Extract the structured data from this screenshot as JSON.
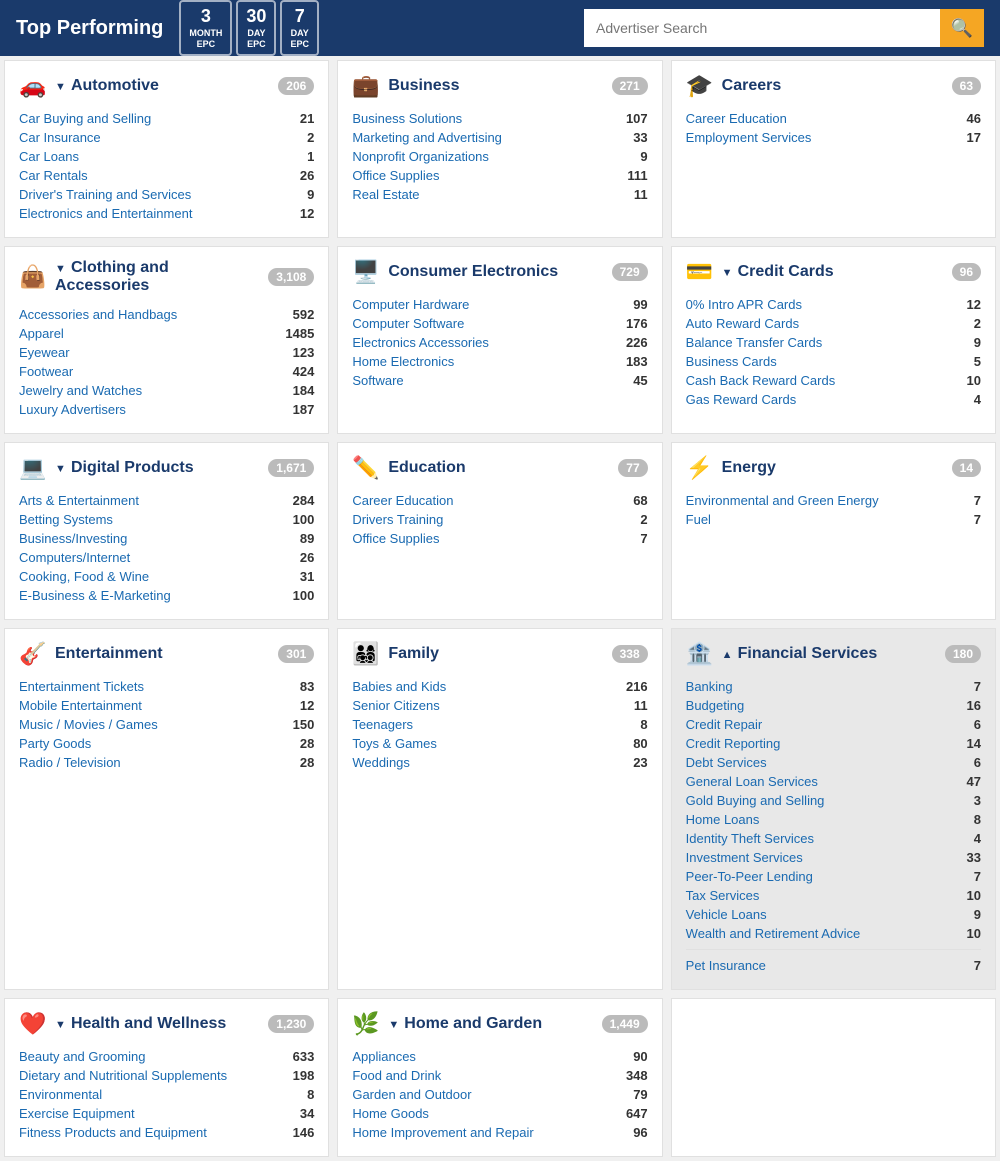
{
  "header": {
    "title": "Top Performing",
    "epc_buttons": [
      {
        "big": "3",
        "small": "MONTH\nEPC"
      },
      {
        "big": "30",
        "small": "DAY\nEPC"
      },
      {
        "big": "7",
        "small": "DAY\nEPC"
      }
    ],
    "search_placeholder": "Advertiser Search"
  },
  "categories": [
    {
      "id": "automotive",
      "icon": "🚗",
      "title": "Automotive",
      "toggle": "▼",
      "count": "206",
      "items": [
        {
          "name": "Car Buying and Selling",
          "count": "21"
        },
        {
          "name": "Car Insurance",
          "count": "2"
        },
        {
          "name": "Car Loans",
          "count": "1"
        },
        {
          "name": "Car Rentals",
          "count": "26"
        },
        {
          "name": "Driver's Training and Services",
          "count": "9"
        },
        {
          "name": "Electronics and Entertainment",
          "count": "12"
        }
      ]
    },
    {
      "id": "business",
      "icon": "💼",
      "title": "Business",
      "toggle": "",
      "count": "271",
      "items": [
        {
          "name": "Business Solutions",
          "count": "107"
        },
        {
          "name": "Marketing and Advertising",
          "count": "33"
        },
        {
          "name": "Nonprofit Organizations",
          "count": "9"
        },
        {
          "name": "Office Supplies",
          "count": "111"
        },
        {
          "name": "Real Estate",
          "count": "11"
        }
      ]
    },
    {
      "id": "careers",
      "icon": "🎓",
      "title": "Careers",
      "toggle": "",
      "count": "63",
      "items": [
        {
          "name": "Career Education",
          "count": "46"
        },
        {
          "name": "Employment Services",
          "count": "17"
        }
      ]
    },
    {
      "id": "clothing",
      "icon": "👜",
      "title": "Clothing and Accessories",
      "toggle": "▼",
      "count": "3,108",
      "items": [
        {
          "name": "Accessories and Handbags",
          "count": "592"
        },
        {
          "name": "Apparel",
          "count": "1485"
        },
        {
          "name": "Eyewear",
          "count": "123"
        },
        {
          "name": "Footwear",
          "count": "424"
        },
        {
          "name": "Jewelry and Watches",
          "count": "184"
        },
        {
          "name": "Luxury Advertisers",
          "count": "187"
        }
      ]
    },
    {
      "id": "consumer-electronics",
      "icon": "🖥️",
      "title": "Consumer Electronics",
      "toggle": "",
      "count": "729",
      "items": [
        {
          "name": "Computer Hardware",
          "count": "99"
        },
        {
          "name": "Computer Software",
          "count": "176"
        },
        {
          "name": "Electronics Accessories",
          "count": "226"
        },
        {
          "name": "Home Electronics",
          "count": "183"
        },
        {
          "name": "Software",
          "count": "45"
        }
      ]
    },
    {
      "id": "credit-cards",
      "icon": "💳",
      "title": "Credit Cards",
      "toggle": "▼",
      "count": "96",
      "items": [
        {
          "name": "0% Intro APR Cards",
          "count": "12"
        },
        {
          "name": "Auto Reward Cards",
          "count": "2"
        },
        {
          "name": "Balance Transfer Cards",
          "count": "9"
        },
        {
          "name": "Business Cards",
          "count": "5"
        },
        {
          "name": "Cash Back Reward Cards",
          "count": "10"
        },
        {
          "name": "Gas Reward Cards",
          "count": "4"
        }
      ]
    },
    {
      "id": "digital-products",
      "icon": "💻",
      "title": "Digital Products",
      "toggle": "▼",
      "count": "1,671",
      "items": [
        {
          "name": "Arts & Entertainment",
          "count": "284"
        },
        {
          "name": "Betting Systems",
          "count": "100"
        },
        {
          "name": "Business/Investing",
          "count": "89"
        },
        {
          "name": "Computers/Internet",
          "count": "26"
        },
        {
          "name": "Cooking, Food & Wine",
          "count": "31"
        },
        {
          "name": "E-Business & E-Marketing",
          "count": "100"
        }
      ]
    },
    {
      "id": "education",
      "icon": "✏️",
      "title": "Education",
      "toggle": "",
      "count": "77",
      "items": [
        {
          "name": "Career Education",
          "count": "68"
        },
        {
          "name": "Drivers Training",
          "count": "2"
        },
        {
          "name": "Office Supplies",
          "count": "7"
        }
      ]
    },
    {
      "id": "energy",
      "icon": "⚡",
      "title": "Energy",
      "toggle": "",
      "count": "14",
      "items": [
        {
          "name": "Environmental and Green Energy",
          "count": "7"
        },
        {
          "name": "Fuel",
          "count": "7"
        }
      ]
    },
    {
      "id": "entertainment",
      "icon": "🎸",
      "title": "Entertainment",
      "toggle": "",
      "count": "301",
      "items": [
        {
          "name": "Entertainment Tickets",
          "count": "83"
        },
        {
          "name": "Mobile Entertainment",
          "count": "12"
        },
        {
          "name": "Music / Movies / Games",
          "count": "150"
        },
        {
          "name": "Party Goods",
          "count": "28"
        },
        {
          "name": "Radio / Television",
          "count": "28"
        }
      ]
    },
    {
      "id": "family",
      "icon": "👨‍👩‍👧‍👦",
      "title": "Family",
      "toggle": "",
      "count": "338",
      "items": [
        {
          "name": "Babies and Kids",
          "count": "216"
        },
        {
          "name": "Senior Citizens",
          "count": "11"
        },
        {
          "name": "Teenagers",
          "count": "8"
        },
        {
          "name": "Toys & Games",
          "count": "80"
        },
        {
          "name": "Weddings",
          "count": "23"
        }
      ]
    },
    {
      "id": "financial-services",
      "icon": "🏦",
      "title": "Financial Services",
      "toggle": "▲",
      "count": "180",
      "highlighted": true,
      "items": [
        {
          "name": "Banking",
          "count": "7"
        },
        {
          "name": "Budgeting",
          "count": "16"
        },
        {
          "name": "Credit Repair",
          "count": "6"
        },
        {
          "name": "Credit Reporting",
          "count": "14"
        },
        {
          "name": "Debt Services",
          "count": "6"
        },
        {
          "name": "General Loan Services",
          "count": "47"
        },
        {
          "name": "Gold Buying and Selling",
          "count": "3"
        },
        {
          "name": "Home Loans",
          "count": "8"
        },
        {
          "name": "Identity Theft Services",
          "count": "4"
        },
        {
          "name": "Investment Services",
          "count": "33"
        },
        {
          "name": "Peer-To-Peer Lending",
          "count": "7"
        },
        {
          "name": "Tax Services",
          "count": "10"
        },
        {
          "name": "Vehicle Loans",
          "count": "9"
        },
        {
          "name": "Wealth and Retirement Advice",
          "count": "10"
        }
      ],
      "extra_items": [
        {
          "name": "Pet Insurance",
          "count": "7"
        }
      ]
    },
    {
      "id": "health-wellness",
      "icon": "❤️",
      "title": "Health and Wellness",
      "toggle": "▼",
      "count": "1,230",
      "items": [
        {
          "name": "Beauty and Grooming",
          "count": "633"
        },
        {
          "name": "Dietary and Nutritional Supplements",
          "count": "198"
        },
        {
          "name": "Environmental",
          "count": "8"
        },
        {
          "name": "Exercise Equipment",
          "count": "34"
        },
        {
          "name": "Fitness Products and Equipment",
          "count": "146"
        }
      ]
    },
    {
      "id": "home-garden",
      "icon": "🌿",
      "title": "Home and Garden",
      "toggle": "▼",
      "count": "1,449",
      "items": [
        {
          "name": "Appliances",
          "count": "90"
        },
        {
          "name": "Food and Drink",
          "count": "348"
        },
        {
          "name": "Garden and Outdoor",
          "count": "79"
        },
        {
          "name": "Home Goods",
          "count": "647"
        },
        {
          "name": "Home Improvement and Repair",
          "count": "96"
        }
      ]
    }
  ]
}
